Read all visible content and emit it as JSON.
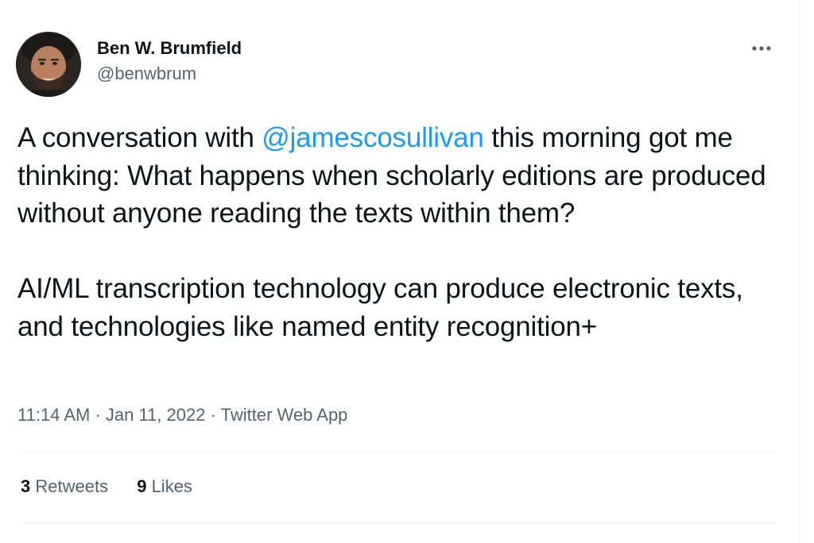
{
  "author": {
    "display_name": "Ben W. Brumfield",
    "handle": "@benwbrum",
    "avatar_icon": "user-avatar"
  },
  "more_icon": "more-dots-icon",
  "tweet": {
    "text_before_mention": "A conversation with ",
    "mention": "@jamescosullivan",
    "text_after_mention": " this morning got me thinking:  What happens when scholarly editions are produced without anyone reading the texts within them?",
    "paragraph2": "AI/ML transcription technology can produce electronic texts, and technologies like named entity recognition+"
  },
  "meta": {
    "time": "11:14 AM",
    "separator": " · ",
    "date": "Jan 11, 2022",
    "source": "Twitter Web App"
  },
  "stats": {
    "retweets_count": "3",
    "retweets_label": " Retweets",
    "likes_count": "9",
    "likes_label": " Likes"
  },
  "colors": {
    "link": "#1d9bf0",
    "secondary_text": "#536471",
    "primary_text": "#0f1419",
    "divider": "#eff3f4"
  }
}
